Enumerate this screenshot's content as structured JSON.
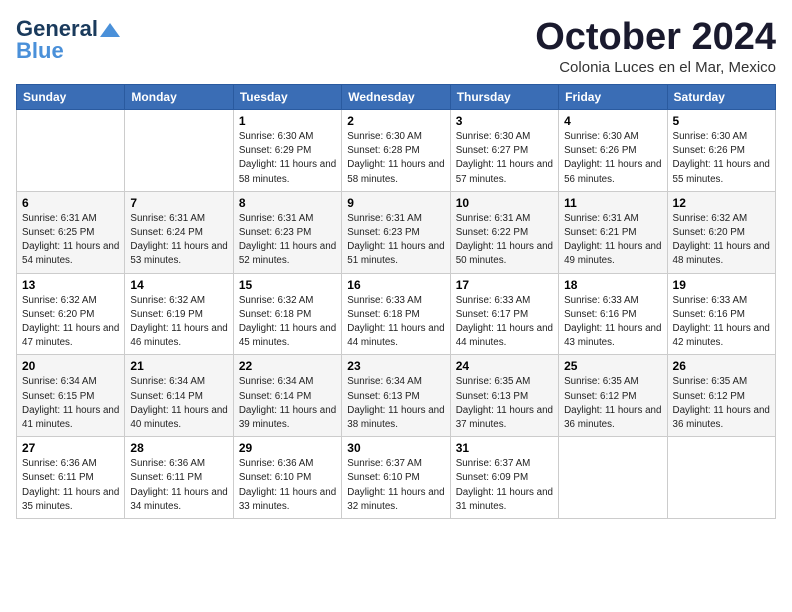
{
  "header": {
    "logo_general": "General",
    "logo_blue": "Blue",
    "month_title": "October 2024",
    "subtitle": "Colonia Luces en el Mar, Mexico"
  },
  "days_of_week": [
    "Sunday",
    "Monday",
    "Tuesday",
    "Wednesday",
    "Thursday",
    "Friday",
    "Saturday"
  ],
  "weeks": [
    [
      {
        "day": "",
        "info": ""
      },
      {
        "day": "",
        "info": ""
      },
      {
        "day": "1",
        "info": "Sunrise: 6:30 AM\nSunset: 6:29 PM\nDaylight: 11 hours and 58 minutes."
      },
      {
        "day": "2",
        "info": "Sunrise: 6:30 AM\nSunset: 6:28 PM\nDaylight: 11 hours and 58 minutes."
      },
      {
        "day": "3",
        "info": "Sunrise: 6:30 AM\nSunset: 6:27 PM\nDaylight: 11 hours and 57 minutes."
      },
      {
        "day": "4",
        "info": "Sunrise: 6:30 AM\nSunset: 6:26 PM\nDaylight: 11 hours and 56 minutes."
      },
      {
        "day": "5",
        "info": "Sunrise: 6:30 AM\nSunset: 6:26 PM\nDaylight: 11 hours and 55 minutes."
      }
    ],
    [
      {
        "day": "6",
        "info": "Sunrise: 6:31 AM\nSunset: 6:25 PM\nDaylight: 11 hours and 54 minutes."
      },
      {
        "day": "7",
        "info": "Sunrise: 6:31 AM\nSunset: 6:24 PM\nDaylight: 11 hours and 53 minutes."
      },
      {
        "day": "8",
        "info": "Sunrise: 6:31 AM\nSunset: 6:23 PM\nDaylight: 11 hours and 52 minutes."
      },
      {
        "day": "9",
        "info": "Sunrise: 6:31 AM\nSunset: 6:23 PM\nDaylight: 11 hours and 51 minutes."
      },
      {
        "day": "10",
        "info": "Sunrise: 6:31 AM\nSunset: 6:22 PM\nDaylight: 11 hours and 50 minutes."
      },
      {
        "day": "11",
        "info": "Sunrise: 6:31 AM\nSunset: 6:21 PM\nDaylight: 11 hours and 49 minutes."
      },
      {
        "day": "12",
        "info": "Sunrise: 6:32 AM\nSunset: 6:20 PM\nDaylight: 11 hours and 48 minutes."
      }
    ],
    [
      {
        "day": "13",
        "info": "Sunrise: 6:32 AM\nSunset: 6:20 PM\nDaylight: 11 hours and 47 minutes."
      },
      {
        "day": "14",
        "info": "Sunrise: 6:32 AM\nSunset: 6:19 PM\nDaylight: 11 hours and 46 minutes."
      },
      {
        "day": "15",
        "info": "Sunrise: 6:32 AM\nSunset: 6:18 PM\nDaylight: 11 hours and 45 minutes."
      },
      {
        "day": "16",
        "info": "Sunrise: 6:33 AM\nSunset: 6:18 PM\nDaylight: 11 hours and 44 minutes."
      },
      {
        "day": "17",
        "info": "Sunrise: 6:33 AM\nSunset: 6:17 PM\nDaylight: 11 hours and 44 minutes."
      },
      {
        "day": "18",
        "info": "Sunrise: 6:33 AM\nSunset: 6:16 PM\nDaylight: 11 hours and 43 minutes."
      },
      {
        "day": "19",
        "info": "Sunrise: 6:33 AM\nSunset: 6:16 PM\nDaylight: 11 hours and 42 minutes."
      }
    ],
    [
      {
        "day": "20",
        "info": "Sunrise: 6:34 AM\nSunset: 6:15 PM\nDaylight: 11 hours and 41 minutes."
      },
      {
        "day": "21",
        "info": "Sunrise: 6:34 AM\nSunset: 6:14 PM\nDaylight: 11 hours and 40 minutes."
      },
      {
        "day": "22",
        "info": "Sunrise: 6:34 AM\nSunset: 6:14 PM\nDaylight: 11 hours and 39 minutes."
      },
      {
        "day": "23",
        "info": "Sunrise: 6:34 AM\nSunset: 6:13 PM\nDaylight: 11 hours and 38 minutes."
      },
      {
        "day": "24",
        "info": "Sunrise: 6:35 AM\nSunset: 6:13 PM\nDaylight: 11 hours and 37 minutes."
      },
      {
        "day": "25",
        "info": "Sunrise: 6:35 AM\nSunset: 6:12 PM\nDaylight: 11 hours and 36 minutes."
      },
      {
        "day": "26",
        "info": "Sunrise: 6:35 AM\nSunset: 6:12 PM\nDaylight: 11 hours and 36 minutes."
      }
    ],
    [
      {
        "day": "27",
        "info": "Sunrise: 6:36 AM\nSunset: 6:11 PM\nDaylight: 11 hours and 35 minutes."
      },
      {
        "day": "28",
        "info": "Sunrise: 6:36 AM\nSunset: 6:11 PM\nDaylight: 11 hours and 34 minutes."
      },
      {
        "day": "29",
        "info": "Sunrise: 6:36 AM\nSunset: 6:10 PM\nDaylight: 11 hours and 33 minutes."
      },
      {
        "day": "30",
        "info": "Sunrise: 6:37 AM\nSunset: 6:10 PM\nDaylight: 11 hours and 32 minutes."
      },
      {
        "day": "31",
        "info": "Sunrise: 6:37 AM\nSunset: 6:09 PM\nDaylight: 11 hours and 31 minutes."
      },
      {
        "day": "",
        "info": ""
      },
      {
        "day": "",
        "info": ""
      }
    ]
  ]
}
